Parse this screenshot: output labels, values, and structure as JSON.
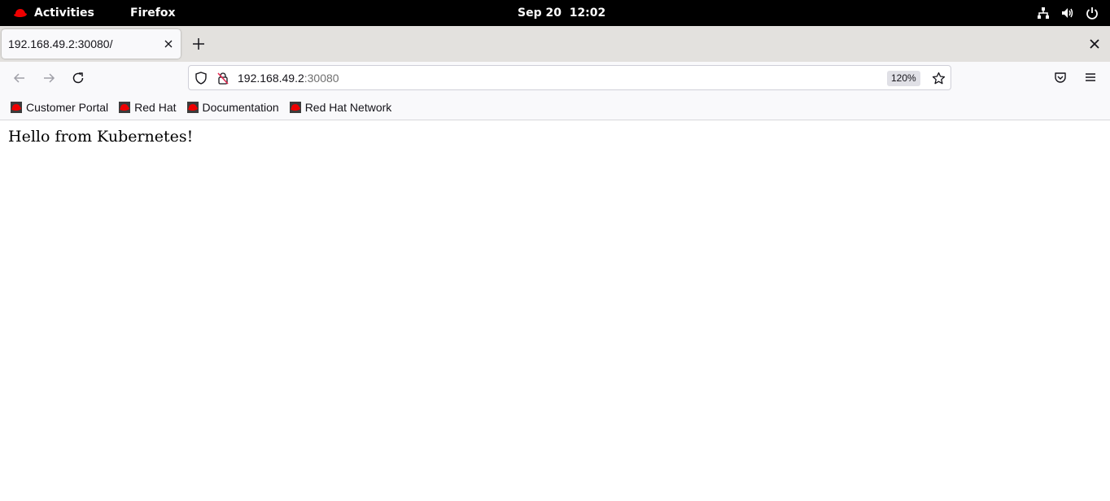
{
  "topbar": {
    "activities_label": "Activities",
    "app_name": "Firefox",
    "clock": "Sep 20  12:02"
  },
  "browser": {
    "tab_title": "192.168.49.2:30080/",
    "url_host": "192.168.49.2",
    "url_port": ":30080",
    "zoom": "120%"
  },
  "bookmarks": [
    {
      "label": "Customer Portal"
    },
    {
      "label": "Red Hat"
    },
    {
      "label": "Documentation"
    },
    {
      "label": "Red Hat Network"
    }
  ],
  "page": {
    "text": "Hello from Kubernetes!"
  },
  "colors": {
    "redhat_red": "#ee0000",
    "topbar_bg": "#000000",
    "tabstrip_bg": "#e3e1de",
    "toolbar_bg": "#f9f9fb"
  }
}
